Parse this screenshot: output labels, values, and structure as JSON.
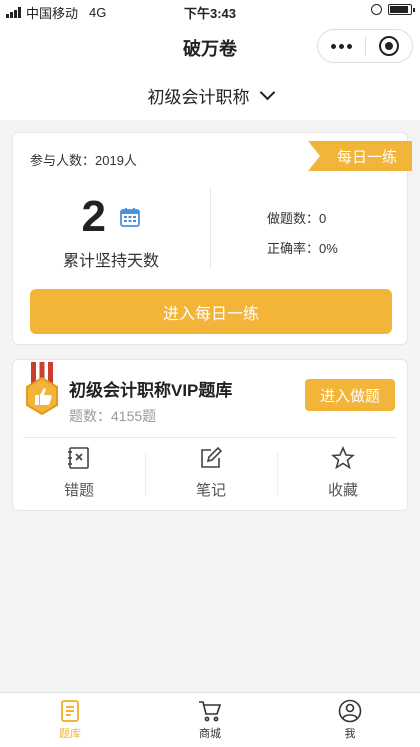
{
  "status_bar": {
    "carrier": "中国移动",
    "network": "4G",
    "time": "下午3:43",
    "battery_level": 0.9
  },
  "nav": {
    "title": "破万卷"
  },
  "subject_selector": {
    "label": "初级会计职称"
  },
  "daily_card": {
    "participants": "参与人数：2019人",
    "ribbon": "每日一练",
    "streak_days": "2",
    "streak_label": "累计坚持天数",
    "done_count": "做题数：0",
    "accuracy": "正确率：0%",
    "button": "进入每日一练"
  },
  "vip_card": {
    "title": "初级会计职称VIP题库",
    "question_count": "题数：4155题",
    "enter_button": "进入做题",
    "actions": [
      {
        "label": "错题",
        "icon": "wrong-questions-icon"
      },
      {
        "label": "笔记",
        "icon": "notes-icon"
      },
      {
        "label": "收藏",
        "icon": "star-icon"
      }
    ]
  },
  "tabs": [
    {
      "label": "题库",
      "icon": "question-bank-icon",
      "active": true
    },
    {
      "label": "商城",
      "icon": "cart-icon",
      "active": false
    },
    {
      "label": "我",
      "icon": "user-icon",
      "active": false
    }
  ],
  "colors": {
    "accent": "#f2b53a",
    "background": "#f4f4f4",
    "medal_red": "#c8402c"
  }
}
